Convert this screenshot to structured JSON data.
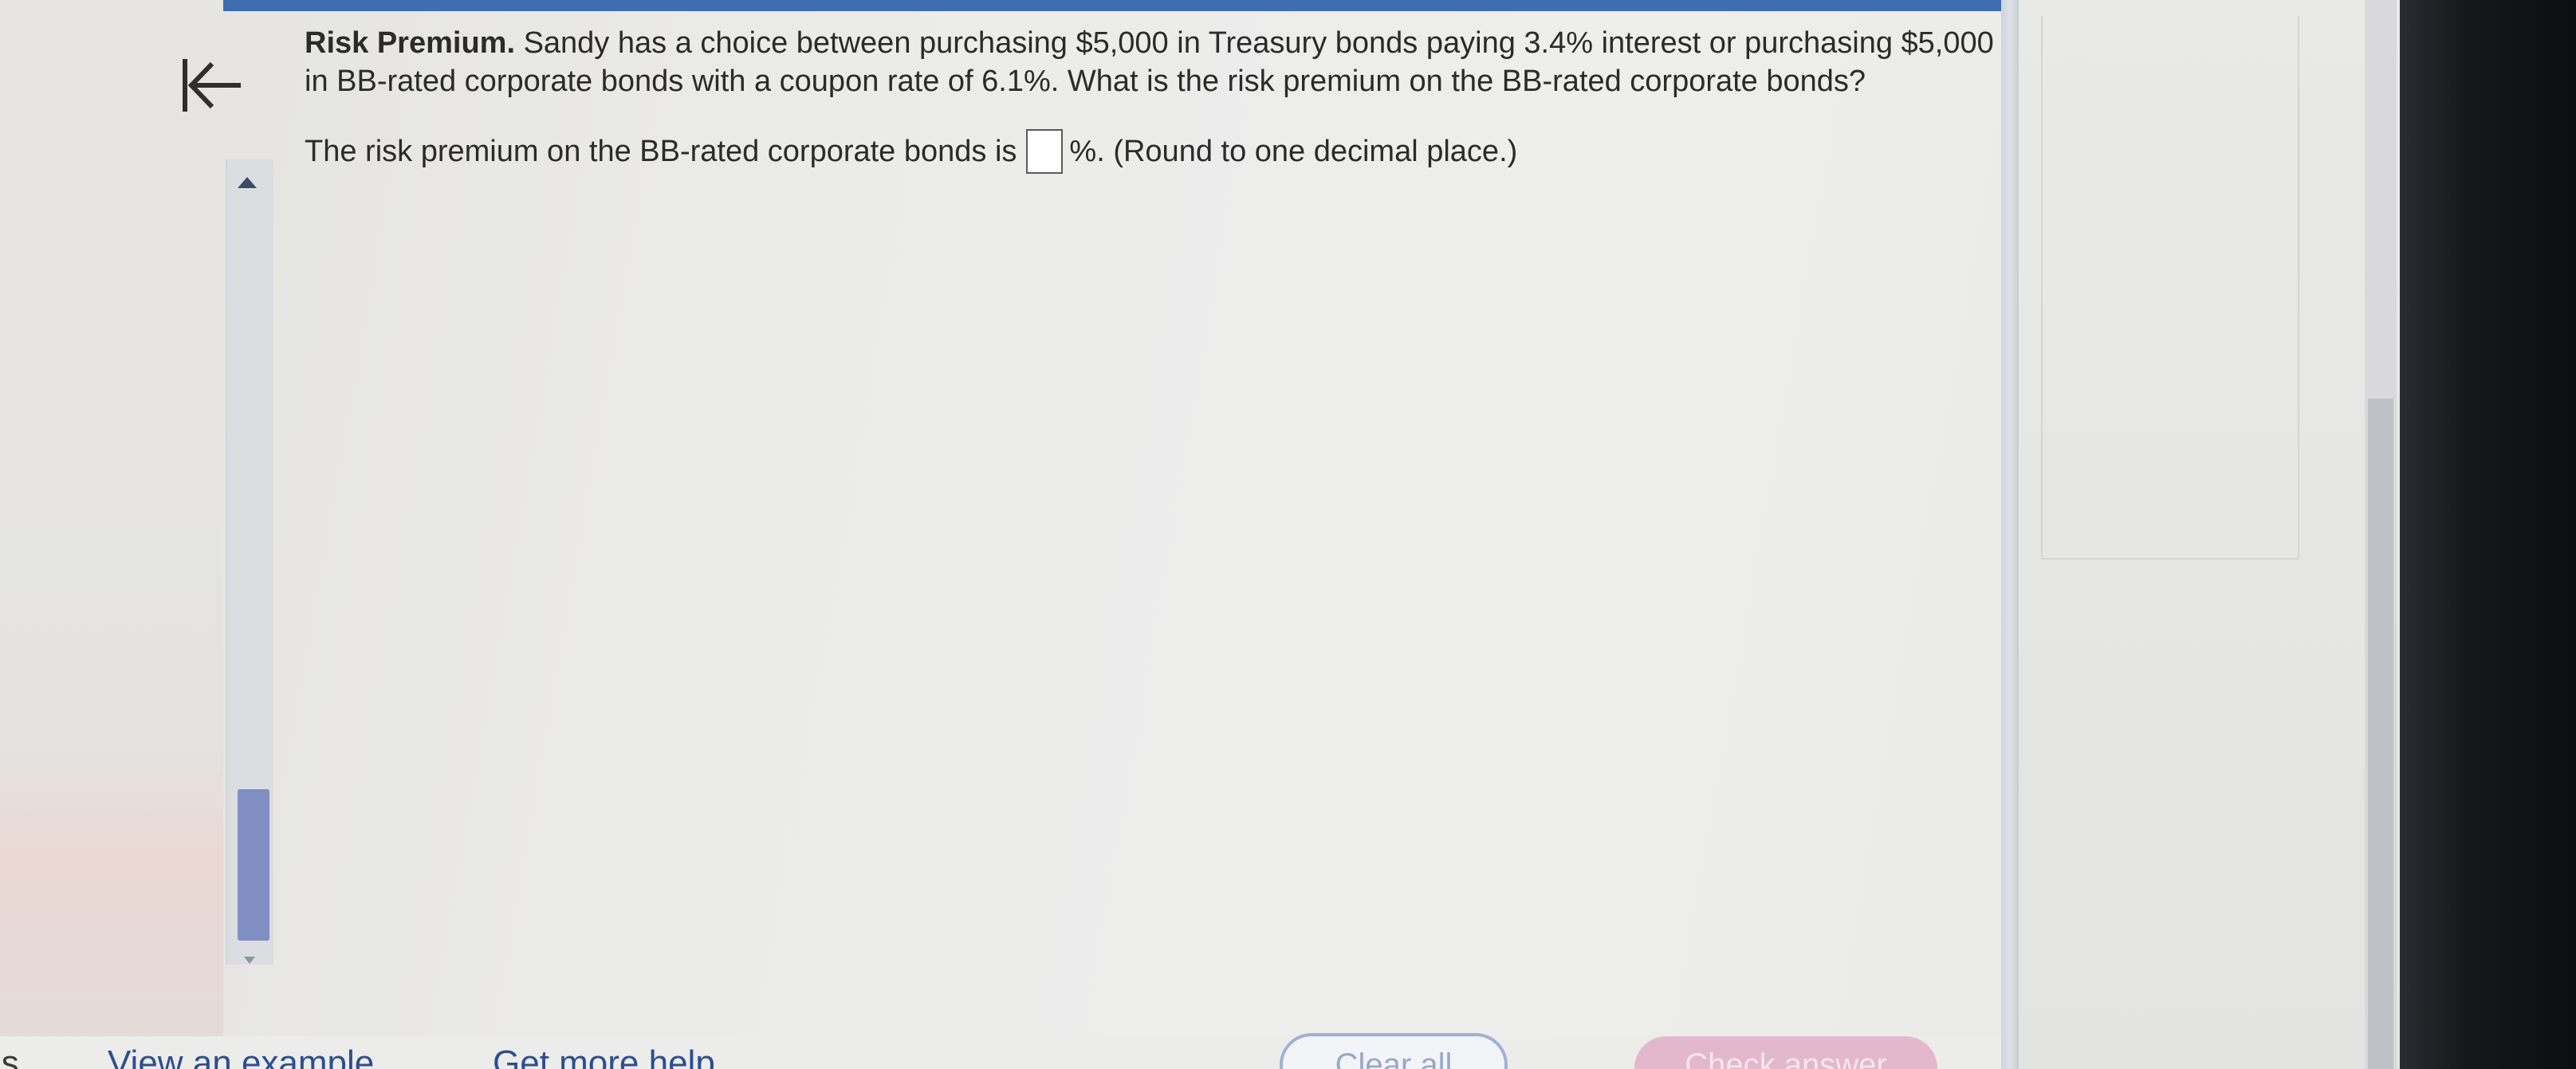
{
  "question": {
    "title": "Risk Premium.",
    "body": "Sandy has a choice between purchasing $5,000 in Treasury bonds paying 3.4% interest or purchasing $5,000 in BB-rated corporate bonds with a coupon rate of 6.1%. What is the risk premium on the BB-rated corporate bonds?"
  },
  "answer": {
    "prefix": "The risk premium on the BB-rated corporate bonds is",
    "value": "",
    "suffix": "%. (Round to one decimal place.)"
  },
  "footer": {
    "partial_left_label": "is",
    "view_example_label": "View an example",
    "get_help_label": "Get more help",
    "clear_all_label": "Clear all",
    "check_answer_label": "Check answer"
  },
  "colors": {
    "accent_blue": "#3e6db0",
    "link_blue": "#2d4e8f",
    "check_button_pink": "#e3b8cc"
  }
}
